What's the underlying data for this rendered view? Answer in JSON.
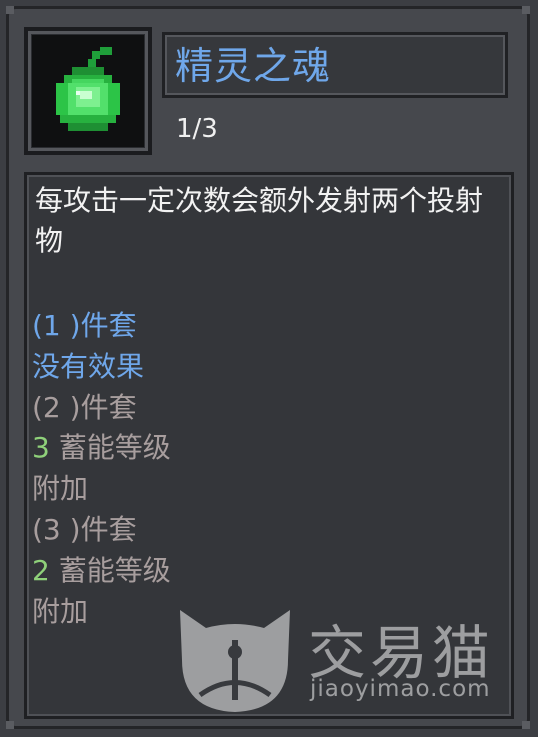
{
  "item": {
    "name": "精灵之魂",
    "count": "1/3",
    "icon": "green-spirit-orb-icon"
  },
  "description": "每攻击一定次数会额外发射两个投射物",
  "set_bonuses": [
    {
      "header": "(1 )件套",
      "effect": "没有效果"
    },
    {
      "header": "(2 )件套",
      "level": "3",
      "effect": " 蓄能等级",
      "extra": "附加"
    },
    {
      "header": "(3 )件套",
      "level": "2",
      "effect": " 蓄能等级",
      "extra": "附加"
    }
  ],
  "watermark": {
    "brand": "交易猫",
    "url": "jiaoyimao.com"
  },
  "colors": {
    "title": "#6fa7ea",
    "active_set": "#6fa7ea",
    "inactive_set": "#a89e9e",
    "level_number": "#8fd17a"
  }
}
